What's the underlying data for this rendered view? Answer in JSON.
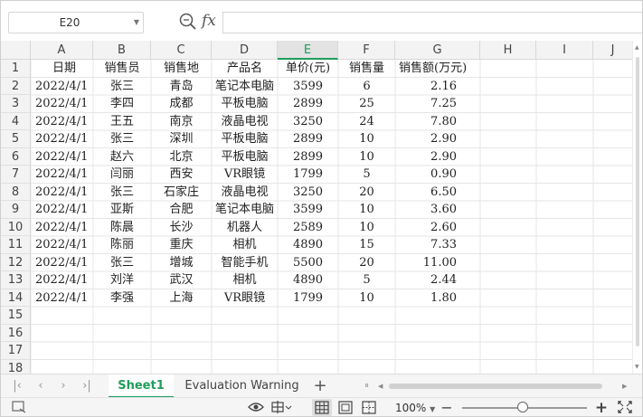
{
  "formula_bar": {
    "name_box": "E20",
    "fx_label": "fx",
    "formula": ""
  },
  "grid": {
    "selected_column": "E",
    "columns": [
      "A",
      "B",
      "C",
      "D",
      "E",
      "F",
      "G",
      "H",
      "I",
      "J"
    ],
    "row_numbers": [
      "1",
      "2",
      "3",
      "4",
      "5",
      "6",
      "7",
      "8",
      "9",
      "10",
      "11",
      "12",
      "13",
      "14",
      "15",
      "16",
      "17",
      "18"
    ],
    "header_row": [
      "日期",
      "销售员",
      "销售地",
      "产品名",
      "单价(元)",
      "销售量",
      "销售额(万元)"
    ],
    "rows": [
      [
        "2022/4/1",
        "张三",
        "青岛",
        "笔记本电脑",
        "3599",
        "6",
        "2.16"
      ],
      [
        "2022/4/1",
        "李四",
        "成都",
        "平板电脑",
        "2899",
        "25",
        "7.25"
      ],
      [
        "2022/4/1",
        "王五",
        "南京",
        "液晶电视",
        "3250",
        "24",
        "7.80"
      ],
      [
        "2022/4/1",
        "张三",
        "深圳",
        "平板电脑",
        "2899",
        "10",
        "2.90"
      ],
      [
        "2022/4/1",
        "赵六",
        "北京",
        "平板电脑",
        "2899",
        "10",
        "2.90"
      ],
      [
        "2022/4/1",
        "闫丽",
        "西安",
        "VR眼镜",
        "1799",
        "5",
        "0.90"
      ],
      [
        "2022/4/1",
        "张三",
        "石家庄",
        "液晶电视",
        "3250",
        "20",
        "6.50"
      ],
      [
        "2022/4/1",
        "亚斯",
        "合肥",
        "笔记本电脑",
        "3599",
        "10",
        "3.60"
      ],
      [
        "2022/4/1",
        "陈晨",
        "长沙",
        "机器人",
        "2589",
        "10",
        "2.60"
      ],
      [
        "2022/4/1",
        "陈丽",
        "重庆",
        "相机",
        "4890",
        "15",
        "7.33"
      ],
      [
        "2022/4/1",
        "张三",
        "增城",
        "智能手机",
        "5500",
        "20",
        "11.00"
      ],
      [
        "2022/4/1",
        "刘洋",
        "武汉",
        "相机",
        "4890",
        "5",
        "2.44"
      ],
      [
        "2022/4/1",
        "李强",
        "上海",
        "VR眼镜",
        "1799",
        "10",
        "1.80"
      ]
    ]
  },
  "sheet_tabs": {
    "tabs": [
      "Sheet1",
      "Evaluation Warning"
    ],
    "active": "Sheet1",
    "add_label": "+"
  },
  "status_bar": {
    "zoom": "100%",
    "zoom_level_percent": 100,
    "zoom_in_label": "+"
  },
  "colors": {
    "accent": "#1f9d5c",
    "header_bg": "#f3f3f3",
    "grid_line": "#e6e6e6"
  },
  "icons": [
    "dropdown-arrow-icon",
    "zoom-lens-icon",
    "first-sheet-icon",
    "prev-sheet-icon",
    "next-sheet-icon",
    "last-sheet-icon",
    "eye-protection-icon",
    "freeze-panes-icon",
    "normal-view-icon",
    "page-layout-view-icon",
    "page-break-view-icon",
    "zoom-in-icon",
    "fullscreen-icon",
    "status-corner-icon"
  ]
}
